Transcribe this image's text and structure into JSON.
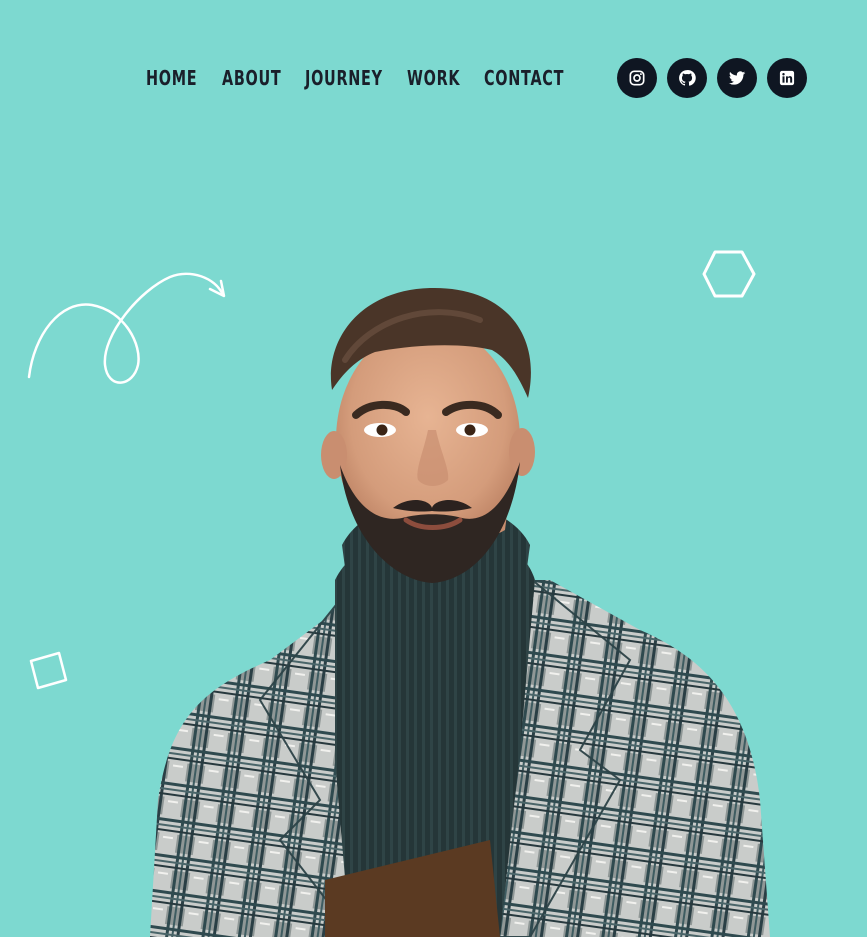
{
  "nav": {
    "items": [
      {
        "label": "HOME"
      },
      {
        "label": "ABOUT"
      },
      {
        "label": "JOURNEY"
      },
      {
        "label": "WORK"
      },
      {
        "label": "CONTACT"
      }
    ]
  },
  "social": [
    {
      "icon": "instagram-icon"
    },
    {
      "icon": "github-icon"
    },
    {
      "icon": "twitter-icon"
    },
    {
      "icon": "linkedin-icon"
    }
  ],
  "colors": {
    "background": "#7dd9d0",
    "nav_text": "#1a1f2a",
    "social_bg": "#0f1622",
    "decoration": "#ffffff"
  }
}
